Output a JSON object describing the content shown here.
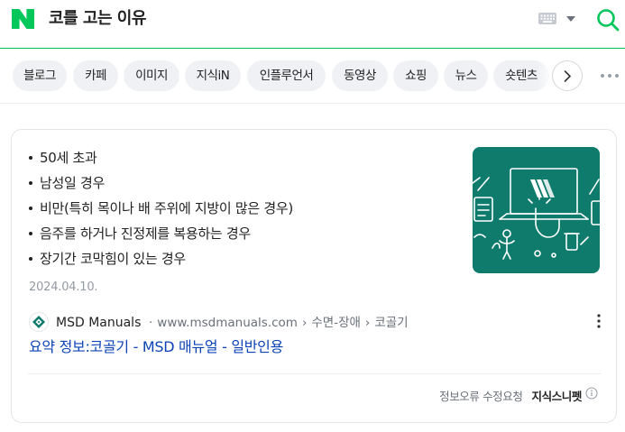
{
  "header": {
    "logo_icon": "naver-n-logo",
    "logo_color": "#03c75a",
    "query": "코를 고는 이유",
    "keyboard_icon": "keyboard-icon",
    "dropdown_icon": "caret-down-icon",
    "search_icon": "search-icon"
  },
  "tabs": [
    {
      "label": "블로그"
    },
    {
      "label": "카페"
    },
    {
      "label": "이미지"
    },
    {
      "label": "지식iN"
    },
    {
      "label": "인플루언서"
    },
    {
      "label": "동영상"
    },
    {
      "label": "쇼핑"
    },
    {
      "label": "뉴스"
    },
    {
      "label": "숏텐츠"
    }
  ],
  "tabs_next_icon": "chevron-right-icon",
  "tabs_more_icon": "more-horizontal-icon",
  "card": {
    "bullets": [
      "50세 초과",
      "남성일 경우",
      "비만(특히 목이나 배 주위에 지방이 많은 경우)",
      "음주를 하거나 진정제를 복용하는 경우",
      "장기간 코막힘이 있는 경우"
    ],
    "thumbnail_color": "#0f7b6c",
    "thumbnail_icon": "msd-laptop-illustration",
    "date": "2024.04.10.",
    "source": {
      "name": "MSD Manuals",
      "domain": "www.msdmanuals.com",
      "path": [
        "수면-장애",
        "코골기"
      ],
      "separator": "›",
      "dot": "·"
    },
    "title": "요약 정보:코골기 - MSD 매뉴얼 - 일반인용",
    "title_color": "#0c43b7",
    "footer": {
      "report_label": "정보오류 수정요청",
      "snippet_label": "지식스니펫",
      "info_icon": "info-icon"
    }
  }
}
